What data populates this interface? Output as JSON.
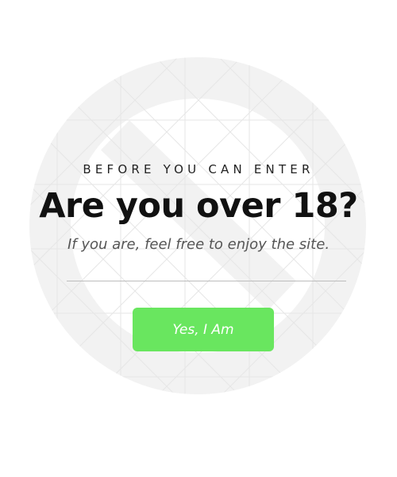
{
  "gate": {
    "overline": "BEFORE YOU CAN ENTER",
    "headline": "Are you over 18?",
    "subline": "If you are, feel free to enjoy the site.",
    "confirm_label": "Yes, I Am"
  },
  "background": {
    "icon": "prohibited-sign-icon"
  },
  "colors": {
    "accent": "#69e65f",
    "sign": "#f2f2f2",
    "grid": "#e3e3e3",
    "heading": "#111111",
    "subtext": "#555555",
    "divider": "#bdbdbd"
  }
}
